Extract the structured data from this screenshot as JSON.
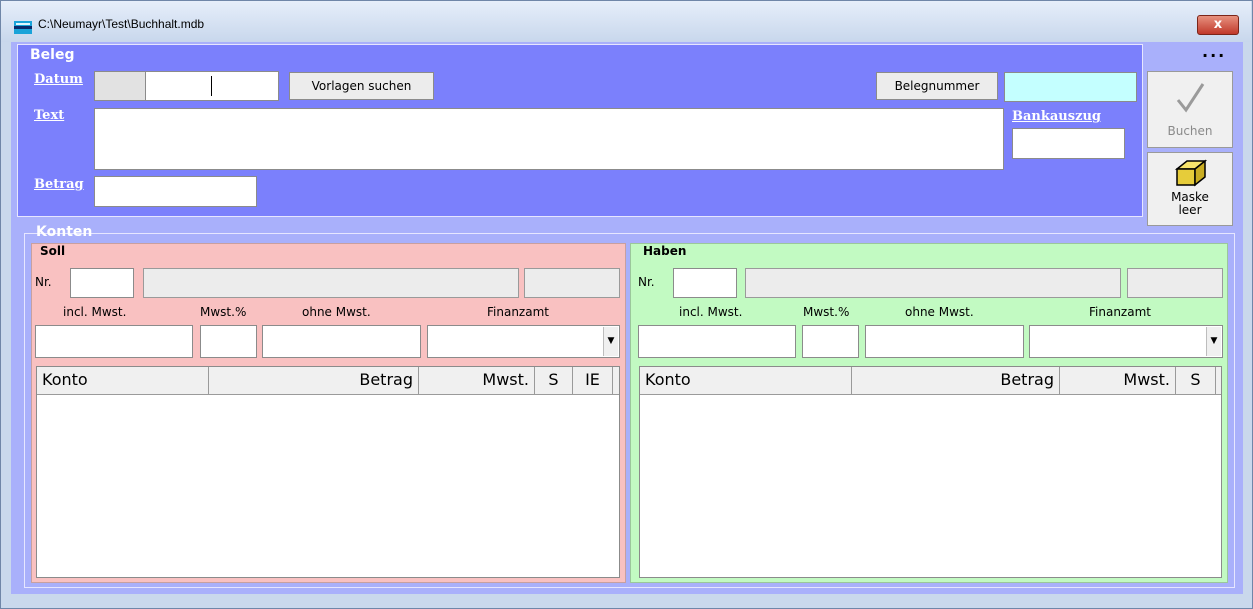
{
  "window": {
    "title": "C:\\Neumayr\\Test\\Buchhalt.mdb",
    "close_label": "x",
    "more_label": "..."
  },
  "beleg": {
    "legend": "Beleg",
    "datum_label": "Datum",
    "text_label": "Text",
    "betrag_label": "Betrag",
    "bankauszug_label": "Bankauszug",
    "vorlagen_button": "Vorlagen suchen",
    "belegnummer_button": "Belegnummer"
  },
  "actions": {
    "buchen_label": "Buchen",
    "maske_leer_line1": "Maske",
    "maske_leer_line2": "leer"
  },
  "konten": {
    "legend": "Konten",
    "soll": {
      "legend": "Soll",
      "nr_label": "Nr.",
      "incl_label": "incl. Mwst.",
      "mwst_label": "Mwst.%",
      "ohne_label": "ohne Mwst.",
      "finanzamt_label": "Finanzamt",
      "columns": [
        "Konto",
        "Betrag",
        "Mwst.",
        "S",
        "IE"
      ]
    },
    "haben": {
      "legend": "Haben",
      "nr_label": "Nr.",
      "incl_label": "incl. Mwst.",
      "mwst_label": "Mwst.%",
      "ohne_label": "ohne Mwst.",
      "finanzamt_label": "Finanzamt",
      "columns": [
        "Konto",
        "Betrag",
        "Mwst.",
        "S"
      ]
    }
  },
  "colors": {
    "beleg_bg": "#7b80fc",
    "soll_bg": "#f9c1c1",
    "haben_bg": "#c2fac2",
    "belegnummer_field": "#c4ffff"
  }
}
